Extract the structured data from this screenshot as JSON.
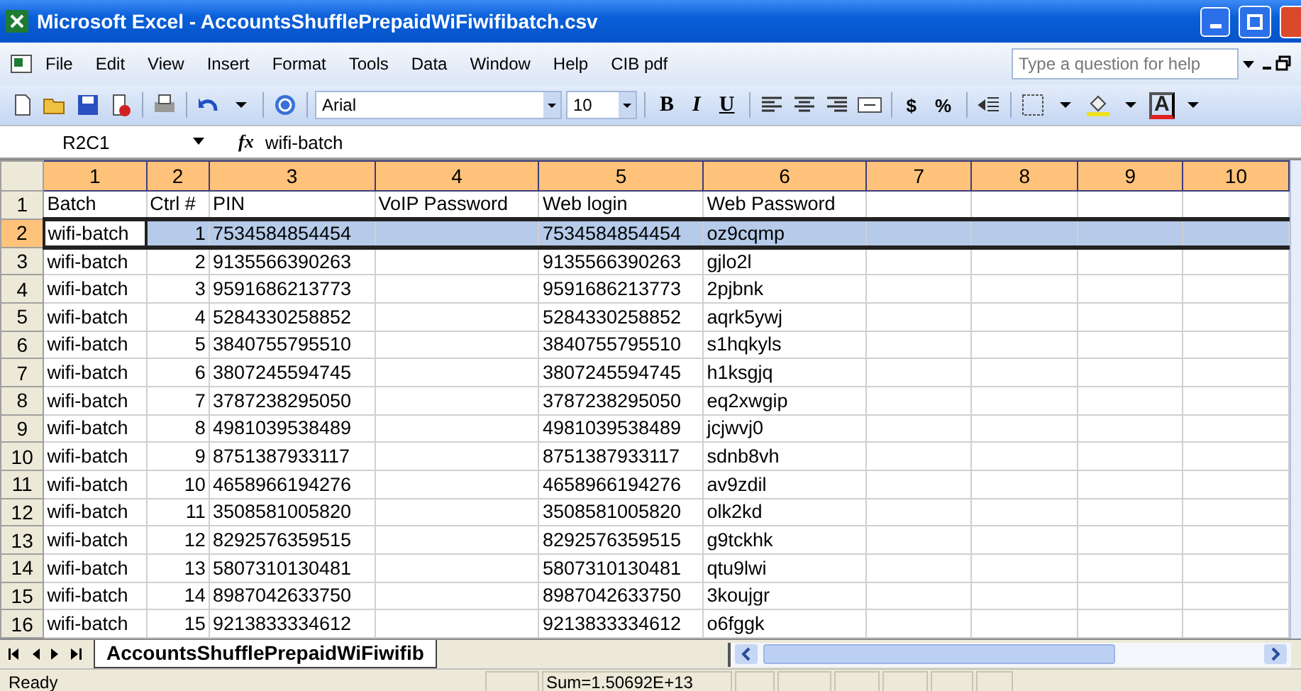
{
  "window": {
    "title": "Microsoft Excel - AccountsShufflePrepaidWiFiwifibatch.csv"
  },
  "menu": [
    "File",
    "Edit",
    "View",
    "Insert",
    "Format",
    "Tools",
    "Data",
    "Window",
    "Help",
    "CIB pdf"
  ],
  "help_box": {
    "placeholder": "Type a question for help"
  },
  "toolbar": {
    "font": "Arial",
    "size": "10",
    "text_buttons": [
      {
        "label": "B",
        "kind": "bold"
      },
      {
        "label": "I",
        "kind": "italic"
      },
      {
        "label": "U",
        "kind": "underline"
      },
      {
        "label": "$",
        "kind": "plain"
      },
      {
        "label": "%",
        "kind": "plain"
      }
    ],
    "font_color_label": "A"
  },
  "name_box": "R2C1",
  "formula_label": "fx",
  "formula": "wifi-batch",
  "columns": [
    {
      "label": "1",
      "selected": true
    },
    {
      "label": "2",
      "selected": true
    },
    {
      "label": "3",
      "selected": true
    },
    {
      "label": "4",
      "selected": true
    },
    {
      "label": "5",
      "selected": true
    },
    {
      "label": "6",
      "selected": true
    },
    {
      "label": "7",
      "selected": true
    },
    {
      "label": "8",
      "selected": true
    },
    {
      "label": "9",
      "selected": true
    },
    {
      "label": "10",
      "selected": true
    }
  ],
  "rows": [
    {
      "number": "1",
      "kind": "header",
      "selected": false,
      "batch": "Batch",
      "ctrl": "Ctrl #",
      "pin": "PIN",
      "voip": "VoIP Password",
      "web_login": "Web login",
      "web_password": "Web Password"
    },
    {
      "number": "2",
      "kind": "data",
      "selected": true,
      "batch": "wifi-batch",
      "ctrl": "1",
      "pin": "7534584854454",
      "web_login": "7534584854454",
      "web_password": "oz9cqmp"
    },
    {
      "number": "3",
      "kind": "data",
      "selected": false,
      "batch": "wifi-batch",
      "ctrl": "2",
      "pin": "9135566390263",
      "web_login": "9135566390263",
      "web_password": "gjlo2l"
    },
    {
      "number": "4",
      "kind": "data",
      "selected": false,
      "batch": "wifi-batch",
      "ctrl": "3",
      "pin": "9591686213773",
      "web_login": "9591686213773",
      "web_password": "2pjbnk"
    },
    {
      "number": "5",
      "kind": "data",
      "selected": false,
      "batch": "wifi-batch",
      "ctrl": "4",
      "pin": "5284330258852",
      "web_login": "5284330258852",
      "web_password": "aqrk5ywj"
    },
    {
      "number": "6",
      "kind": "data",
      "selected": false,
      "batch": "wifi-batch",
      "ctrl": "5",
      "pin": "3840755795510",
      "web_login": "3840755795510",
      "web_password": "s1hqkyls"
    },
    {
      "number": "7",
      "kind": "data",
      "selected": false,
      "batch": "wifi-batch",
      "ctrl": "6",
      "pin": "3807245594745",
      "web_login": "3807245594745",
      "web_password": "h1ksgjq"
    },
    {
      "number": "8",
      "kind": "data",
      "selected": false,
      "batch": "wifi-batch",
      "ctrl": "7",
      "pin": "3787238295050",
      "web_login": "3787238295050",
      "web_password": "eq2xwgip"
    },
    {
      "number": "9",
      "kind": "data",
      "selected": false,
      "batch": "wifi-batch",
      "ctrl": "8",
      "pin": "4981039538489",
      "web_login": "4981039538489",
      "web_password": "jcjwvj0"
    },
    {
      "number": "10",
      "kind": "data",
      "selected": false,
      "batch": "wifi-batch",
      "ctrl": "9",
      "pin": "8751387933117",
      "web_login": "8751387933117",
      "web_password": "sdnb8vh"
    },
    {
      "number": "11",
      "kind": "data",
      "selected": false,
      "batch": "wifi-batch",
      "ctrl": "10",
      "pin": "4658966194276",
      "web_login": "4658966194276",
      "web_password": "av9zdil"
    },
    {
      "number": "12",
      "kind": "data",
      "selected": false,
      "batch": "wifi-batch",
      "ctrl": "11",
      "pin": "3508581005820",
      "web_login": "3508581005820",
      "web_password": "olk2kd"
    },
    {
      "number": "13",
      "kind": "data",
      "selected": false,
      "batch": "wifi-batch",
      "ctrl": "12",
      "pin": "8292576359515",
      "web_login": "8292576359515",
      "web_password": "g9tckhk"
    },
    {
      "number": "14",
      "kind": "data",
      "selected": false,
      "batch": "wifi-batch",
      "ctrl": "13",
      "pin": "5807310130481",
      "web_login": "5807310130481",
      "web_password": "qtu9lwi"
    },
    {
      "number": "15",
      "kind": "data",
      "selected": false,
      "batch": "wifi-batch",
      "ctrl": "14",
      "pin": "8987042633750",
      "web_login": "8987042633750",
      "web_password": "3koujgr"
    },
    {
      "number": "16",
      "kind": "data",
      "selected": false,
      "batch": "wifi-batch",
      "ctrl": "15",
      "pin": "9213833334612",
      "web_login": "9213833334612",
      "web_password": "o6fggk"
    }
  ],
  "sheet_tabs": [
    {
      "label": "AccountsShufflePrepaidWiFiwifib",
      "selected": true
    }
  ],
  "status_bar": {
    "state": "Ready",
    "sum": "Sum=1.50692E+13"
  }
}
